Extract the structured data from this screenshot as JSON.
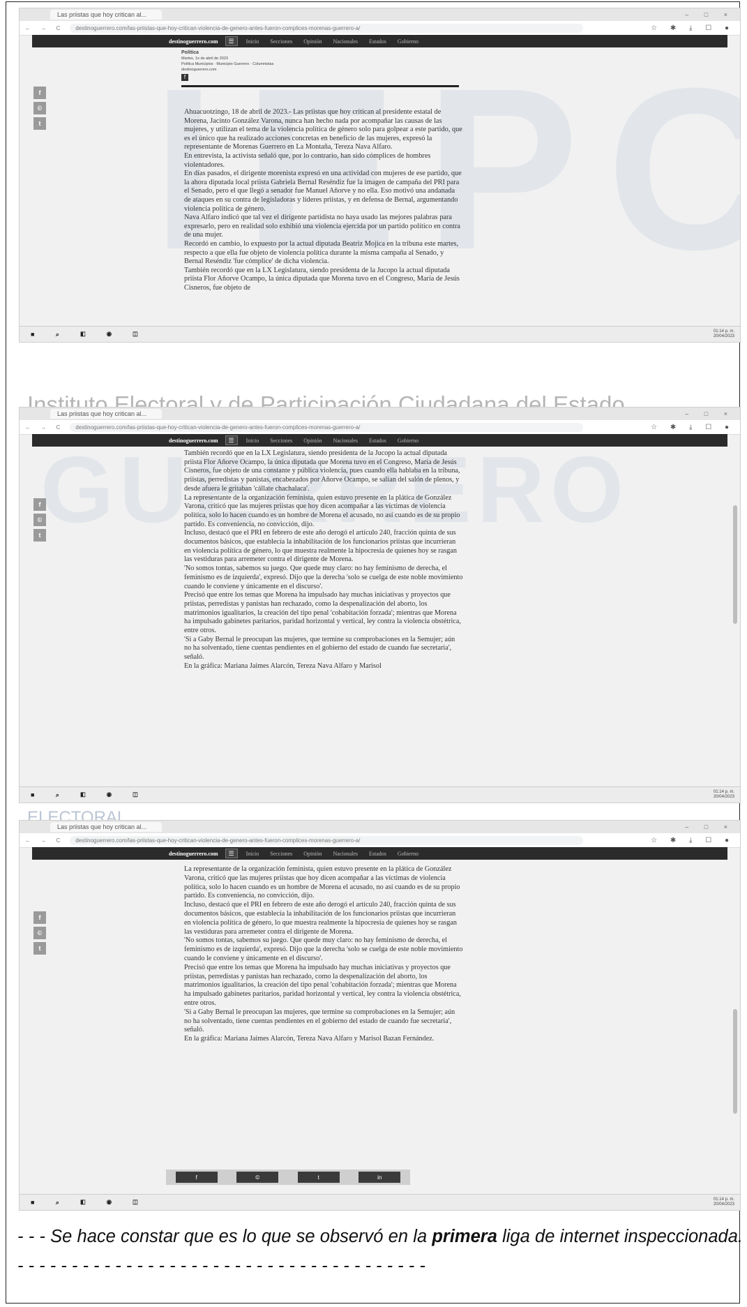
{
  "browser": {
    "tab_label": "Las priistas que hoy critican al...",
    "url": "destinoguerrero.com/las-priistas-que-hoy-critican-violencia-de-genero-antes-fueron-complices-morenas-guerrero-a/",
    "nav_controls": "← → C",
    "window_controls": "–  □  ×",
    "extension_icons": "☆ ✱ ⤓ ☐ ●"
  },
  "site": {
    "brand": "destinoguerrero.com",
    "menu_icon": "☰",
    "menu": [
      "Inicio",
      "Secciones",
      "Opinión",
      "Nacionales",
      "Estados",
      "Gobierno"
    ],
    "social_side": [
      "f",
      "©",
      "t"
    ]
  },
  "article_meta": {
    "category": "Política",
    "date": "Martes, 1o de abril de 2023",
    "section": "Política Municipios · Municipio Guerrero · Columnistas",
    "author": "destinoguerrero.com",
    "fb_icon": "f"
  },
  "shot1": {
    "paragraphs": [
      "Ahuacuotzingo, 18 de abril de 2023.- Las priistas que hoy critican al presidente estatal de Morena, Jacinto González Varona, nunca han hecho nada por acompañar las causas de las mujeres, y utilizan el tema de la violencia política de género solo para golpear a este partido, que es el único que ha realizado acciones concretas en beneficio de las mujeres, expresó la representante de Morenas Guerrero en La Montaña, Tereza Nava Alfaro.",
      "En entrevista, la activista señaló que, por lo contrario, han sido cómplices de hombres violentadores.",
      "En días pasados, el dirigente morenista expresó en una actividad con mujeres de ese partido, que la ahora diputada local priista Gabriela Bernal Reséndiz fue la imagen de campaña del PRI para el Senado, pero el que llegó a senador fue Manuel Añorve y no ella. Eso motivó una andanada de ataques en su contra de legisladoras y líderes priistas, y en defensa de Bernal, argumentando violencia política de género.",
      "Nava Alfaro indicó que tal vez el dirigente partidista no haya usado las mejores palabras para expresarlo, pero en realidad solo exhibió una violencia ejercida por un partido político en contra de una mujer.",
      "Recordó en cambio, lo expuesto por la actual diputada Beatriz Mojica en la tribuna este martes, respecto a que ella fue objeto de violencia política durante la misma campaña al Senado, y Bernal Reséndiz 'fue cómplice' de dicha violencia.",
      "También recordó que en la LX Legislatura, siendo presidenta de la Jucopo la actual diputada priista Flor Añorve Ocampo, la única diputada que Morena tuvo en el Congreso, María de Jesús Cisneros, fue objeto de"
    ]
  },
  "shot2": {
    "paragraphs": [
      "También recordó que en la LX Legislatura, siendo presidenta de la Jucopo la actual diputada priista Flor Añorve Ocampo, la única diputada que Morena tuvo en el Congreso, María de Jesús Cisneros, fue objeto de una constante y pública violencia, pues cuando ella hablaba en la tribuna, priistas, perredistas y panistas, encabezados por Añorve Ocampo, se salían del salón de plenos, y desde afuera le gritaban 'cállate chachalaca'.",
      "La representante de la organización feminista, quien estuvo presente en la plática de González Varona, criticó que las mujeres priistas que hoy dicen acompañar a las víctimas de violencia política, solo lo hacen cuando es un hombre de Morena el acusado, no así cuando es de su propio partido. Es conveniencia, no convicción, dijo.",
      "Incluso, destacó que el PRI en febrero de este año derogó el artículo 240, fracción quinta de sus documentos básicos, que establecía la inhabilitación de los funcionarios priistas que incurrieran en violencia política de género, lo que muestra realmente la hipocresía de quienes hoy se rasgan las vestiduras para arremeter contra el dirigente de Morena.",
      "'No somos tontas, sabemos su juego. Que quede muy claro: no hay feminismo de derecha, el feminismo es de izquierda', expresó. Dijo que la derecha 'solo se cuelga de este noble movimiento cuando le conviene y únicamente en el discurso'.",
      "Precisó que entre los temas que Morena ha impulsado hay muchas iniciativas y proyectos que priistas, perredistas y panistas han rechazado, como la despenalización del aborto, los matrimonios igualitarios, la creación del tipo penal 'cohabitación forzada'; mientras que Morena ha impulsado gabinetes paritarios, paridad horizontal y vertical, ley contra la violencia obstétrica, entre otros.",
      "'Si a Gaby Bernal le preocupan las mujeres, que termine su comprobaciones en la Semujer; aún no ha solventado, tiene cuentas pendientes en el gobierno del estado de cuando fue secretaria', señaló.",
      "En la gráfica: Mariana Jaimes Alarcón, Tereza Nava Alfaro y Marisol"
    ]
  },
  "shot3": {
    "paragraphs": [
      "La representante de la organización feminista, quien estuvo presente en la plática de González Varona, criticó que las mujeres priistas que hoy dicen acompañar a las víctimas de violencia política, solo lo hacen cuando es un hombre de Morena el acusado, no así cuando es de su propio partido. Es conveniencia, no convicción, dijo.",
      "Incluso, destacó que el PRI en febrero de este año derogó el artículo 240, fracción quinta de sus documentos básicos, que establecía la inhabilitación de los funcionarios priistas que incurrieran en violencia política de género, lo que muestra realmente la hipocresía de quienes hoy se rasgan las vestiduras para arremeter contra el dirigente de Morena.",
      "'No somos tontas, sabemos su juego. Que quede muy claro: no hay feminismo de derecha, el feminismo es de izquierda', expresó. Dijo que la derecha 'solo se cuelga de este noble movimiento cuando le conviene y únicamente en el discurso'.",
      "Precisó que entre los temas que Morena ha impulsado hay muchas iniciativas y proyectos que priistas, perredistas y panistas han rechazado, como la despenalización del aborto, los matrimonios igualitarios, la creación del tipo penal 'cohabitación forzada'; mientras que Morena ha impulsado gabinetes paritarios, paridad horizontal y vertical, ley contra la violencia obstétrica, entre otros.",
      "'Si a Gaby Bernal le preocupan las mujeres, que termine su comprobaciones en la Semujer; aún no ha solventado, tiene cuentas pendientes en el gobierno del estado de cuando fue secretaria', señaló.",
      "En la gráfica: Mariana Jaimes Alarcón, Tereza Nava Alfaro y Marisol Bazan Fernández."
    ],
    "share_buttons": [
      "f",
      "©",
      "t",
      "in"
    ]
  },
  "taskbar": {
    "icons": "■ ⌕ ◧ ◉ ◫",
    "clock_time": "01:14 p. m.",
    "clock_date": "20/04/2023"
  },
  "watermarks": {
    "background_letters": "IEPC",
    "banner_text": "Instituto Electoral y de Participación Ciudadana del Estado",
    "banner_word": "GUERRERO",
    "banner_word_2": "ELECTORAL"
  },
  "caption": {
    "prefix": "- - - Se hace constar que es lo que se observó en la ",
    "emphasis": "primera",
    "suffix": " liga de internet inspeccionada. - - - - - - - - - - - - - - - - - - - - - - - - - - - - - - - - - - - - - -"
  }
}
